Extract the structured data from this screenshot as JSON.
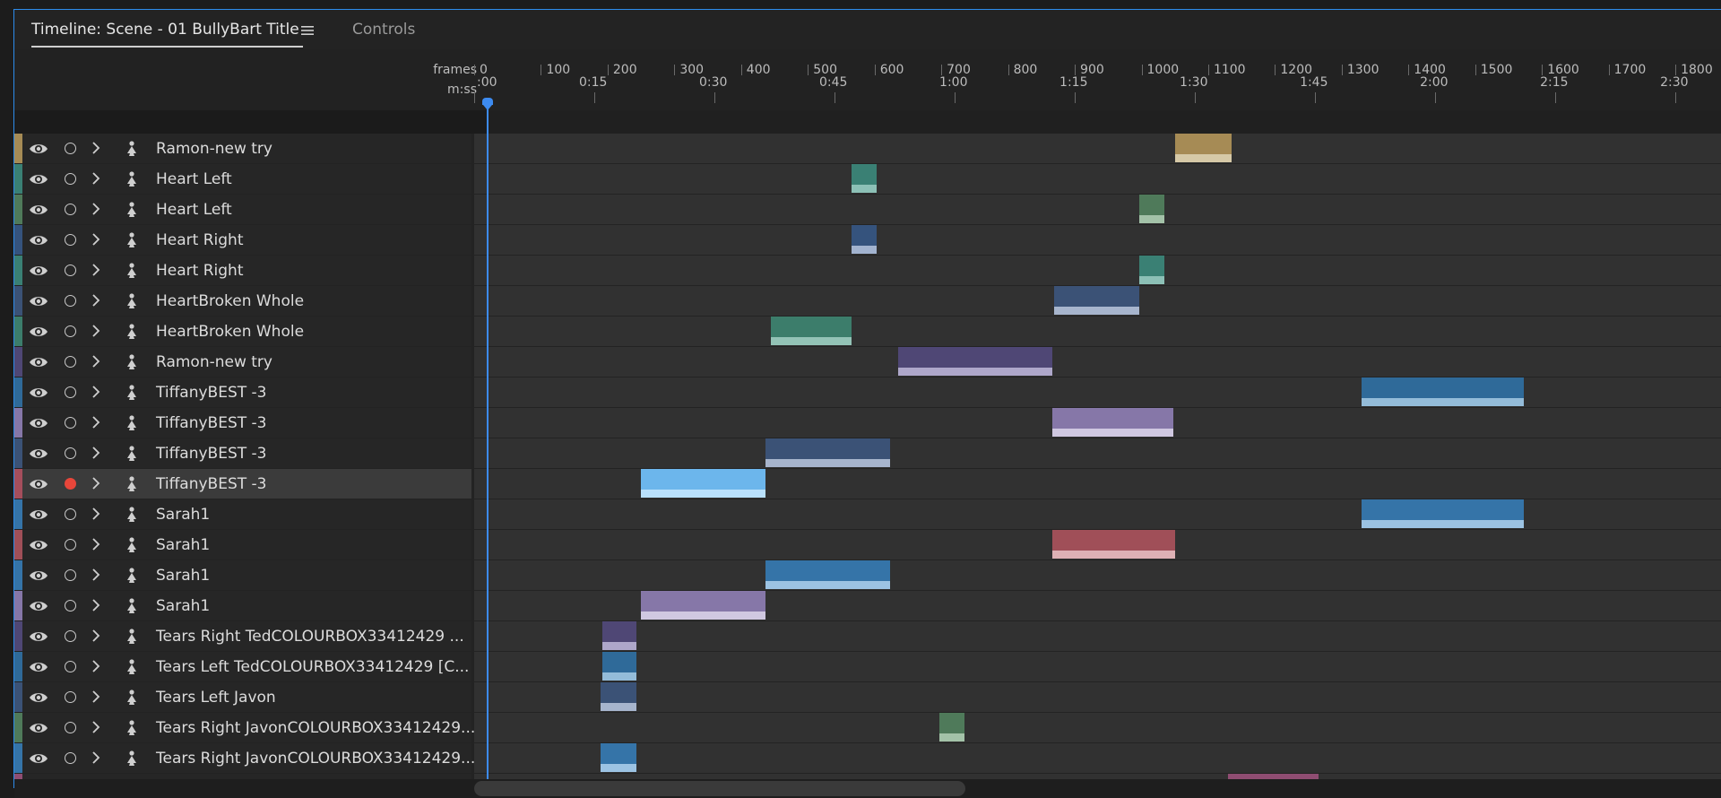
{
  "tabs": {
    "timeline": "Timeline: Scene - 01 BullyBart Title",
    "controls": "Controls"
  },
  "icons": {
    "panel_menu": "hamburger-menu-icon",
    "visibility": "eye-icon",
    "record": "record-circle-icon",
    "expand": "chevron-right-icon",
    "puppet": "puppet-figure-icon"
  },
  "ruler": {
    "frames_label": "frames",
    "time_label": "m:ss",
    "frames": [
      "0",
      "100",
      "200",
      "300",
      "400",
      "500",
      "600",
      "700",
      "800",
      "900",
      "1000",
      "1100",
      "1200",
      "1300",
      "1400",
      "1500",
      "1600",
      "1700",
      "1800"
    ],
    "times": [
      ":00",
      "0:15",
      "0:30",
      "0:45",
      "1:00",
      "1:15",
      "1:30",
      "1:45",
      "2:00",
      "2:15",
      "2:30"
    ]
  },
  "playhead_frame": 0,
  "colors": {
    "accent": "#2d8ceb",
    "record_active": "#e8463a"
  },
  "tracks": [
    {
      "name": "Ramon-new try",
      "color": "#a68b55",
      "recording": false,
      "selected": false,
      "clips": [
        {
          "start": 1050,
          "end": 1135,
          "color": "#a68b55",
          "lower": "#d6c9a7"
        }
      ]
    },
    {
      "name": "Heart Left",
      "color": "#3a8074",
      "recording": false,
      "selected": false,
      "clips": [
        {
          "start": 565,
          "end": 603,
          "color": "#3a8074",
          "lower": "#8cc0b6"
        }
      ]
    },
    {
      "name": "Heart Left",
      "color": "#4f7a5a",
      "recording": false,
      "selected": false,
      "clips": [
        {
          "start": 997,
          "end": 1034,
          "color": "#4f7a5a",
          "lower": "#a3c2a8"
        }
      ]
    },
    {
      "name": "Heart Right",
      "color": "#35537d",
      "recording": false,
      "selected": false,
      "clips": [
        {
          "start": 565,
          "end": 603,
          "color": "#35537d",
          "lower": "#a2b3cf"
        }
      ]
    },
    {
      "name": "Heart Right",
      "color": "#3a8074",
      "recording": false,
      "selected": false,
      "clips": [
        {
          "start": 997,
          "end": 1034,
          "color": "#3a8074",
          "lower": "#8cc0b6"
        }
      ]
    },
    {
      "name": "HeartBroken Whole",
      "color": "#3b5276",
      "recording": false,
      "selected": false,
      "clips": [
        {
          "start": 869,
          "end": 997,
          "color": "#3b5276",
          "lower": "#a7b5cd"
        }
      ]
    },
    {
      "name": "HeartBroken Whole",
      "color": "#3c7d6b",
      "recording": false,
      "selected": false,
      "clips": [
        {
          "start": 444,
          "end": 565,
          "color": "#3c7d6b",
          "lower": "#93c3b6"
        }
      ]
    },
    {
      "name": "Ramon-new try",
      "color": "#4f4775",
      "recording": false,
      "selected": false,
      "clips": [
        {
          "start": 635,
          "end": 867,
          "color": "#4f4775",
          "lower": "#aea7ca"
        }
      ]
    },
    {
      "name": "TiffanyBEST -3",
      "color": "#2f6a99",
      "recording": false,
      "selected": false,
      "clips": [
        {
          "start": 1330,
          "end": 1573,
          "color": "#2f6a99",
          "lower": "#94bcd9"
        }
      ]
    },
    {
      "name": "TiffanyBEST -3",
      "color": "#8677a8",
      "recording": false,
      "selected": false,
      "clips": [
        {
          "start": 867,
          "end": 1048,
          "color": "#8677a8",
          "lower": "#d0c8e1"
        }
      ]
    },
    {
      "name": "TiffanyBEST -3",
      "color": "#3b5276",
      "recording": false,
      "selected": false,
      "clips": [
        {
          "start": 437,
          "end": 623,
          "color": "#3b5276",
          "lower": "#a7b5cd"
        }
      ]
    },
    {
      "name": "TiffanyBEST -3",
      "color": "#a54e5c",
      "recording": true,
      "selected": true,
      "clips": [
        {
          "start": 250,
          "end": 437,
          "color": "#6cb6ec",
          "lower": "#b9e0fb"
        }
      ]
    },
    {
      "name": "Sarah1",
      "color": "#3574a8",
      "recording": false,
      "selected": false,
      "clips": [
        {
          "start": 1330,
          "end": 1573,
          "color": "#3574a8",
          "lower": "#9cc3e3"
        }
      ]
    },
    {
      "name": "Sarah1",
      "color": "#a04f58",
      "recording": false,
      "selected": false,
      "clips": [
        {
          "start": 867,
          "end": 1050,
          "color": "#a04f58",
          "lower": "#deb1b5"
        }
      ]
    },
    {
      "name": "Sarah1",
      "color": "#3574a8",
      "recording": false,
      "selected": false,
      "clips": [
        {
          "start": 437,
          "end": 623,
          "color": "#3574a8",
          "lower": "#9cc3e3"
        }
      ]
    },
    {
      "name": "Sarah1",
      "color": "#8677a8",
      "recording": false,
      "selected": false,
      "clips": [
        {
          "start": 250,
          "end": 437,
          "color": "#8677a8",
          "lower": "#d0c8e1"
        }
      ]
    },
    {
      "name": "Tears Right TedCOLOURBOX33412429 ...",
      "color": "#4f4775",
      "recording": false,
      "selected": false,
      "clips": [
        {
          "start": 192,
          "end": 243,
          "color": "#4f4775",
          "lower": "#aea7ca"
        }
      ]
    },
    {
      "name": "Tears Left TedCOLOURBOX33412429 [C...",
      "color": "#2f6a99",
      "recording": false,
      "selected": false,
      "clips": [
        {
          "start": 192,
          "end": 243,
          "color": "#2f6a99",
          "lower": "#94bcd9"
        }
      ]
    },
    {
      "name": "Tears Left Javon",
      "color": "#3b5276",
      "recording": false,
      "selected": false,
      "clips": [
        {
          "start": 190,
          "end": 243,
          "color": "#3b5276",
          "lower": "#a7b5cd"
        }
      ]
    },
    {
      "name": "Tears Right JavonCOLOURBOX33412429...",
      "color": "#4f7a5a",
      "recording": false,
      "selected": false,
      "clips": [
        {
          "start": 697,
          "end": 735,
          "color": "#4f7a5a",
          "lower": "#a3c2a8"
        }
      ]
    },
    {
      "name": "Tears Right JavonCOLOURBOX33412429...",
      "color": "#3574a8",
      "recording": false,
      "selected": false,
      "clips": [
        {
          "start": 190,
          "end": 243,
          "color": "#3574a8",
          "lower": "#9cc3e3"
        }
      ]
    },
    {
      "name": "",
      "color": "#8f4d72",
      "recording": false,
      "selected": false,
      "clips": [
        {
          "start": 1130,
          "end": 1265,
          "color": "#8f4d72",
          "lower": "#d1a6bd"
        }
      ]
    }
  ]
}
